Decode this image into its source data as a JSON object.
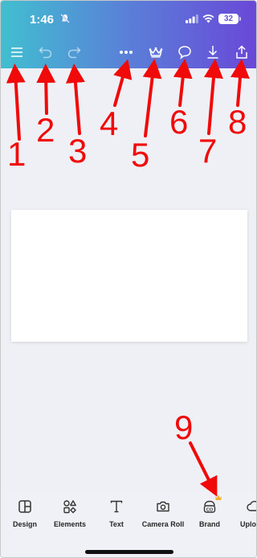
{
  "status_bar": {
    "time": "1:46",
    "battery": "32"
  },
  "toolbar": {
    "items": [
      {
        "icon": "menu-icon"
      },
      {
        "icon": "undo-icon"
      },
      {
        "icon": "redo-icon"
      },
      {
        "icon": "more-icon"
      },
      {
        "icon": "crown-icon"
      },
      {
        "icon": "comment-icon"
      },
      {
        "icon": "download-icon"
      },
      {
        "icon": "share-icon"
      }
    ]
  },
  "bottom_bar": {
    "items": [
      {
        "label": "Design",
        "icon": "design-icon"
      },
      {
        "label": "Elements",
        "icon": "elements-icon"
      },
      {
        "label": "Text",
        "icon": "text-icon"
      },
      {
        "label": "Camera Roll",
        "icon": "camera-icon"
      },
      {
        "label": "Brand",
        "icon": "brand-icon"
      },
      {
        "label": "Uplo",
        "icon": "upload-icon"
      }
    ]
  },
  "annotations": {
    "labels": [
      "1",
      "2",
      "3",
      "4",
      "5",
      "6",
      "7",
      "8",
      "9"
    ],
    "color": "#f00a0a"
  },
  "colors": {
    "header_start": "#41bfd0",
    "header_end": "#6a47d8",
    "canvas_bg": "#eff0f5",
    "crown_badge": "#f2b22e"
  }
}
